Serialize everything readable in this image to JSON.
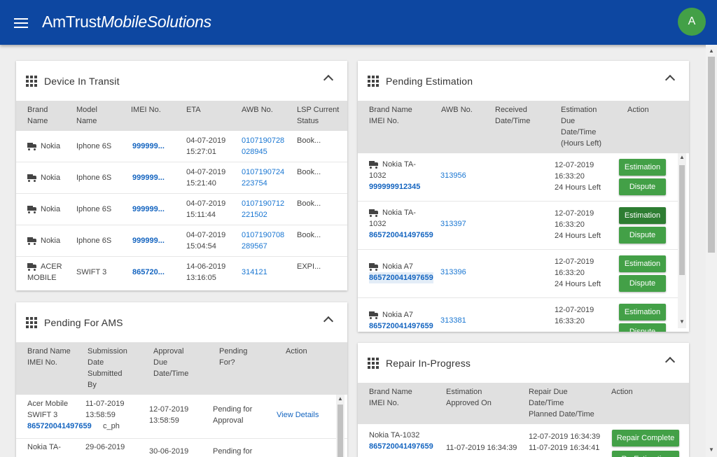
{
  "header": {
    "brand_plain": "AmTrust",
    "brand_italic": "MobileSolutions",
    "avatar_initial": "A"
  },
  "transit": {
    "title": "Device In Transit",
    "columns": [
      "Brand Name",
      "Model Name",
      "IMEI No.",
      "ETA",
      "AWB No.",
      "LSP Current Status"
    ],
    "rows": [
      {
        "brand": "Nokia",
        "model": "Iphone 6S",
        "imei": "999999...",
        "eta_date": "04-07-2019",
        "eta_time": "15:27:01",
        "awb1": "0107190728",
        "awb2": "028945",
        "status": "Book..."
      },
      {
        "brand": "Nokia",
        "model": "Iphone 6S",
        "imei": "999999...",
        "eta_date": "04-07-2019",
        "eta_time": "15:21:40",
        "awb1": "0107190724",
        "awb2": "223754",
        "status": "Book..."
      },
      {
        "brand": "Nokia",
        "model": "Iphone 6S",
        "imei": "999999...",
        "eta_date": "04-07-2019",
        "eta_time": "15:11:44",
        "awb1": "0107190712",
        "awb2": "221502",
        "status": "Book..."
      },
      {
        "brand": "Nokia",
        "model": "Iphone 6S",
        "imei": "999999...",
        "eta_date": "04-07-2019",
        "eta_time": "15:04:54",
        "awb1": "0107190708",
        "awb2": "289567",
        "status": "Book..."
      },
      {
        "brand": "ACER MOBILE",
        "model": "SWIFT 3",
        "imei": "865720...",
        "eta_date": "14-06-2019",
        "eta_time": "13:16:05",
        "awb1": "314121",
        "awb2": "",
        "status": "EXPI..."
      }
    ]
  },
  "ams": {
    "title": "Pending For AMS",
    "col_brand": "Brand Name",
    "col_imei": "IMEI No.",
    "col_submission": [
      "Submission",
      "Date",
      "Submitted",
      "By"
    ],
    "col_approval": [
      "Approval",
      "Due",
      "Date/Time"
    ],
    "col_pending": [
      "Pending",
      "For?"
    ],
    "col_action": "Action",
    "rows": [
      {
        "brand1": "Acer Mobile",
        "brand2": "SWIFT 3",
        "imei": "865720041497659",
        "sub_date": "11-07-2019",
        "sub_time": "13:58:59",
        "sub_by": "c_ph",
        "app_date": "12-07-2019",
        "app_time": "13:58:59",
        "pending1": "Pending for",
        "pending2": "Approval",
        "action": "View Details"
      },
      {
        "brand1": "Nokia TA-",
        "sub_date": "29-06-2019",
        "app_date": "30-06-2019",
        "pending1": "Pending for"
      }
    ]
  },
  "estimation": {
    "title": "Pending Estimation",
    "col_brand": "Brand Name",
    "col_imei": "IMEI No.",
    "col_awb": "AWB No.",
    "col_received": [
      "Received",
      "Date/Time"
    ],
    "col_due": [
      "Estimation",
      "Due",
      "Date/Time",
      "(Hours Left)"
    ],
    "col_action": "Action",
    "btn_estimation": "Estimation",
    "btn_dispute": "Dispute",
    "rows": [
      {
        "brand1": "Nokia TA-",
        "brand2": "1032",
        "imei": "999999912345",
        "awb": "313956",
        "due_date": "12-07-2019",
        "due_time": "16:33:20",
        "hours": "24 Hours Left"
      },
      {
        "brand1": "Nokia TA-",
        "brand2": "1032",
        "imei": "865720041497659",
        "awb": "313397",
        "due_date": "12-07-2019",
        "due_time": "16:33:20",
        "hours": "24 Hours Left"
      },
      {
        "brand1": "Nokia A7",
        "brand2": "",
        "imei": "865720041497659",
        "awb": "313396",
        "due_date": "12-07-2019",
        "due_time": "16:33:20",
        "hours": "24 Hours Left"
      },
      {
        "brand1": "Nokia A7",
        "brand2": "",
        "imei": "865720041497659",
        "awb": "313381",
        "due_date": "12-07-2019",
        "due_time": "16:33:20",
        "hours": ""
      }
    ]
  },
  "repair": {
    "title": "Repair In-Progress",
    "col_brand": "Brand Name",
    "col_imei": "IMEI No.",
    "col_approved": [
      "Estimation",
      "Approved On"
    ],
    "col_due": [
      "Repair Due",
      "Date/Time",
      "Planned Date/Time"
    ],
    "col_action": "Action",
    "rows": [
      {
        "brand": "Nokia TA-1032",
        "imei": "865720041497659",
        "approved": "11-07-2019 16:34:39",
        "due": "12-07-2019 16:34:39",
        "planned": "11-07-2019 16:34:41",
        "btn_complete": "Repair Complete",
        "btn_re": "Re-Estimation"
      }
    ]
  }
}
